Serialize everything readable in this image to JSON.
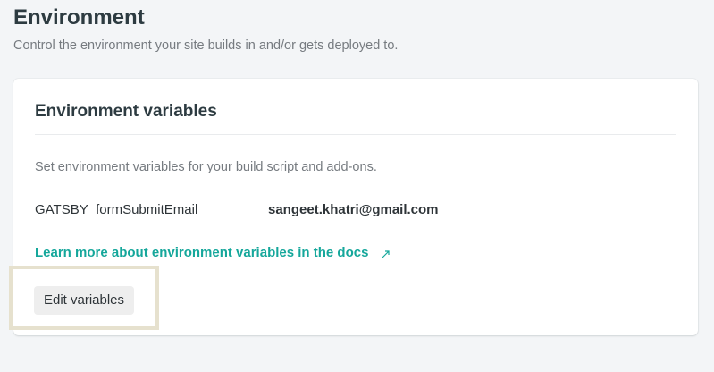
{
  "page": {
    "title": "Environment",
    "subtitle": "Control the environment your site builds in and/or gets deployed to."
  },
  "env_card": {
    "title": "Environment variables",
    "description": "Set environment variables for your build script and add-ons.",
    "variables": [
      {
        "key": "GATSBY_formSubmitEmail",
        "value": "sangeet.khatri@gmail.com"
      }
    ],
    "docs_link_label": "Learn more about environment variables in the docs",
    "docs_link_icon": "external-link-icon",
    "edit_button_label": "Edit variables"
  },
  "colors": {
    "background": "#f3f5f7",
    "link": "#15a79b",
    "highlight_border": "#e6e1ce",
    "button_bg": "#eeeeee"
  }
}
